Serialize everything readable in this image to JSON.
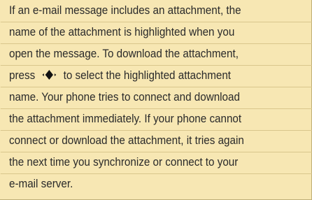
{
  "paragraph": {
    "lines": [
      "If an e-mail message includes an attachment, the",
      "name of the attachment is highlighted when you",
      "open the message. To download the attachment,",
      [
        "press",
        "to select the highlighted attachment"
      ],
      "name. Your phone tries to connect and download",
      "the attachment immediately. If your phone cannot",
      "connect or download the attachment, it tries again",
      "the next time you synchronize or connect to your",
      "e-mail server."
    ],
    "icon": "navigation-key-icon"
  }
}
